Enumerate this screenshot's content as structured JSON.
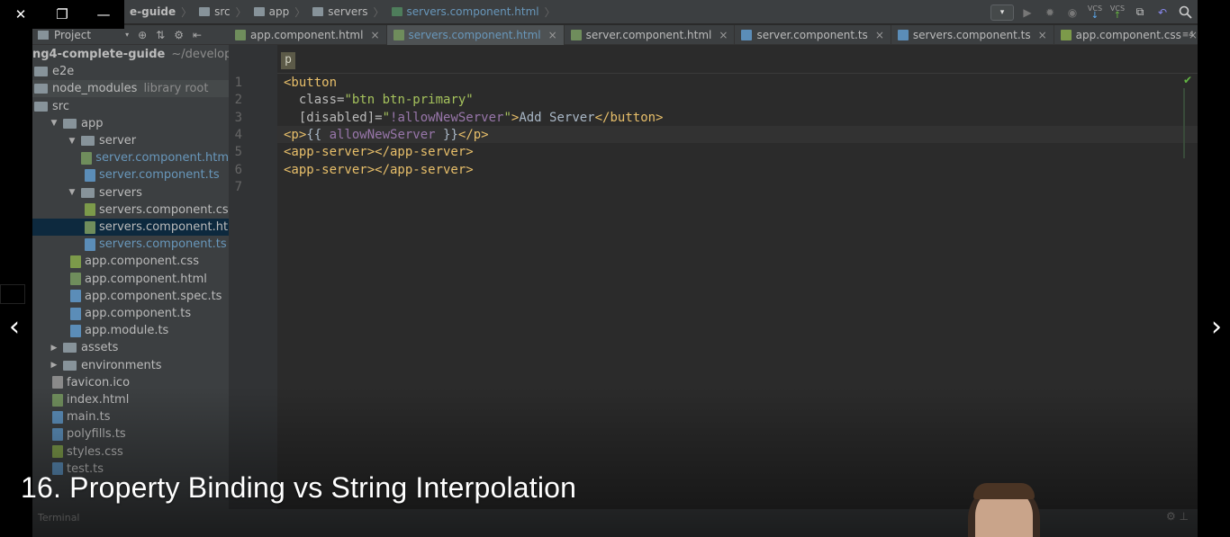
{
  "window_controls": {
    "close": "✕",
    "restore": "❐",
    "minimize": "—"
  },
  "breadcrumbs": [
    {
      "label": "e-guide",
      "type": "folder"
    },
    {
      "label": "src",
      "type": "folder"
    },
    {
      "label": "app",
      "type": "folder"
    },
    {
      "label": "servers",
      "type": "folder"
    },
    {
      "label": "servers.component.html",
      "type": "file"
    }
  ],
  "toolbar": {
    "run_config_dropdown": "▾",
    "vcs_update": "VCS",
    "vcs_commit": "VCS",
    "search_icon": "search-icon"
  },
  "project_panel": {
    "title": "Project",
    "dropdown": "▾"
  },
  "tree": [
    {
      "label": "ng4-complete-guide",
      "extra": "~/developme",
      "level": 0,
      "kind": "root",
      "bold": true
    },
    {
      "label": "e2e",
      "level": 0,
      "kind": "folder"
    },
    {
      "label": "node_modules",
      "extra": "library root",
      "level": 0,
      "kind": "folder"
    },
    {
      "label": "src",
      "level": 0,
      "kind": "folder"
    },
    {
      "label": "app",
      "level": 1,
      "kind": "folder",
      "open": true
    },
    {
      "label": "server",
      "level": 2,
      "kind": "folder",
      "open": true
    },
    {
      "label": "server.component.htm",
      "level": 3,
      "kind": "html",
      "color": "blue"
    },
    {
      "label": "server.component.ts",
      "level": 3,
      "kind": "ts",
      "color": "blue"
    },
    {
      "label": "servers",
      "level": 2,
      "kind": "folder",
      "open": true
    },
    {
      "label": "servers.component.cs",
      "level": 3,
      "kind": "css"
    },
    {
      "label": "servers.component.ht",
      "level": 3,
      "kind": "html",
      "selected": true
    },
    {
      "label": "servers.component.ts",
      "level": 3,
      "kind": "ts",
      "color": "blue"
    },
    {
      "label": "app.component.css",
      "level": 2,
      "kind": "css"
    },
    {
      "label": "app.component.html",
      "level": 2,
      "kind": "html"
    },
    {
      "label": "app.component.spec.ts",
      "level": 2,
      "kind": "ts"
    },
    {
      "label": "app.component.ts",
      "level": 2,
      "kind": "ts"
    },
    {
      "label": "app.module.ts",
      "level": 2,
      "kind": "ts"
    },
    {
      "label": "assets",
      "level": 1,
      "kind": "folder",
      "open": false
    },
    {
      "label": "environments",
      "level": 1,
      "kind": "folder",
      "open": false
    },
    {
      "label": "favicon.ico",
      "level": 1,
      "kind": "gen"
    },
    {
      "label": "index.html",
      "level": 1,
      "kind": "html"
    },
    {
      "label": "main.ts",
      "level": 1,
      "kind": "ts"
    },
    {
      "label": "polyfills.ts",
      "level": 1,
      "kind": "ts"
    },
    {
      "label": "styles.css",
      "level": 1,
      "kind": "css"
    },
    {
      "label": "test.ts",
      "level": 1,
      "kind": "ts"
    }
  ],
  "tabs": [
    {
      "label": "app.component.html",
      "kind": "html"
    },
    {
      "label": "servers.component.html",
      "kind": "html",
      "active": true
    },
    {
      "label": "server.component.html",
      "kind": "html"
    },
    {
      "label": "server.component.ts",
      "kind": "ts"
    },
    {
      "label": "servers.component.ts",
      "kind": "ts"
    },
    {
      "label": "app.component.css",
      "kind": "css"
    }
  ],
  "tabs_more": "≡4",
  "editor": {
    "tag_breadcrumb": "p",
    "line_numbers": [
      "1",
      "2",
      "3",
      "4",
      "5",
      "6",
      "7"
    ],
    "lines": [
      [
        {
          "t": "<button",
          "c": "kw"
        }
      ],
      [
        {
          "t": "  class=",
          "c": "at"
        },
        {
          "t": "\"btn btn-primary\"",
          "c": "st"
        }
      ],
      [
        {
          "t": "  [disabled]=",
          "c": "at"
        },
        {
          "t": "\"",
          "c": "st"
        },
        {
          "t": "!allowNewServer",
          "c": "in"
        },
        {
          "t": "\"",
          "c": "st"
        },
        {
          "t": ">",
          "c": "kw"
        },
        {
          "t": "Add Server",
          "c": "tx"
        },
        {
          "t": "</button>",
          "c": "kw"
        }
      ],
      [
        {
          "t": "<p>",
          "c": "kw"
        },
        {
          "t": "{{ ",
          "c": "tx"
        },
        {
          "t": "allowNewServer ",
          "c": "in"
        },
        {
          "t": "}}",
          "c": "tx"
        },
        {
          "t": "</p>",
          "c": "kw"
        }
      ],
      [
        {
          "t": "<app-server></app-server>",
          "c": "kw"
        }
      ],
      [
        {
          "t": "<app-server></app-server>",
          "c": "kw"
        }
      ],
      [
        {
          "t": "",
          "c": "tx"
        }
      ]
    ]
  },
  "terminal": {
    "label": "Terminal"
  },
  "video": {
    "lecture_title": "16. Property Binding vs String Interpolation",
    "prev_arrow": "‹",
    "next_arrow": "›"
  }
}
